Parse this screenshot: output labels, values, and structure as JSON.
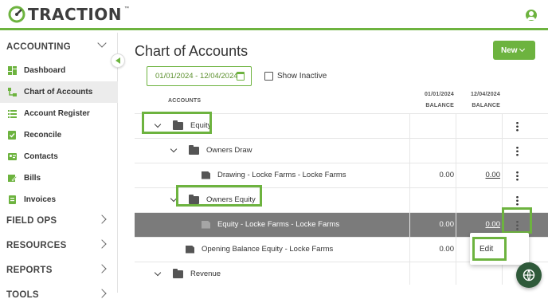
{
  "app": {
    "logo_text": "TRACTION",
    "logo_tm": "™",
    "accent_color": "#6db33f"
  },
  "sidebar": {
    "accounting_section": "ACCOUNTING",
    "items": [
      {
        "label": "Dashboard",
        "icon": "dashboard-icon"
      },
      {
        "label": "Chart of Accounts",
        "icon": "chart-of-accounts-icon"
      },
      {
        "label": "Account Register",
        "icon": "list-icon"
      },
      {
        "label": "Reconcile",
        "icon": "reconcile-icon"
      },
      {
        "label": "Contacts",
        "icon": "contacts-icon"
      },
      {
        "label": "Bills",
        "icon": "bills-icon"
      },
      {
        "label": "Invoices",
        "icon": "invoices-icon"
      }
    ],
    "sections": [
      "FIELD OPS",
      "RESOURCES",
      "REPORTS",
      "TOOLS"
    ]
  },
  "main": {
    "title": "Chart of Accounts",
    "new_button": "New",
    "date_range": "01/01/2024 - 12/04/2024",
    "show_inactive": "Show Inactive"
  },
  "table": {
    "headers": {
      "accounts": "ACCOUNTS",
      "col1_date": "01/01/2024",
      "col1_label": "BALANCE",
      "col2_date": "12/04/2024",
      "col2_label": "BALANCE"
    },
    "rows": [
      {
        "name": "Equity",
        "type": "folder",
        "bal1": "",
        "bal2": ""
      },
      {
        "name": "Owners Draw",
        "type": "folder",
        "bal1": "",
        "bal2": ""
      },
      {
        "name": "Drawing - Locke Farms - Locke Farms",
        "type": "account",
        "bal1": "0.00",
        "bal2": "0.00"
      },
      {
        "name": "Owners Equity",
        "type": "folder",
        "bal1": "",
        "bal2": ""
      },
      {
        "name": "Equity - Locke Farms - Locke Farms",
        "type": "account",
        "bal1": "0.00",
        "bal2": "0.00"
      },
      {
        "name": "Opening Balance Equity - Locke Farms",
        "type": "account",
        "bal1": "0.00",
        "bal2": ""
      },
      {
        "name": "Revenue",
        "type": "folder",
        "bal1": "",
        "bal2": ""
      }
    ]
  },
  "context_menu": {
    "edit": "Edit"
  }
}
